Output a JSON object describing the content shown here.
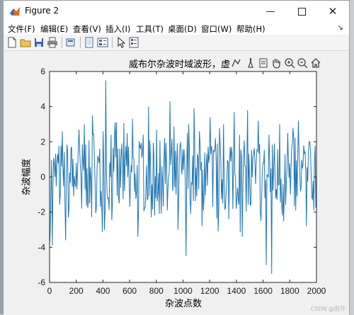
{
  "window": {
    "title": "Figure 2"
  },
  "menu": [
    "文件(F)",
    "编辑(E)",
    "查看(V)",
    "插入(I)",
    "工具(T)",
    "桌面(D)",
    "窗口(W)",
    "帮助(H)"
  ],
  "toolbar_icons": [
    "new-figure-icon",
    "open-file-icon",
    "save-icon",
    "print-icon",
    "print-preview-icon",
    "dock-icon",
    "insert-legend-icon",
    "edit-plot-arrow-icon",
    "property-inspector-icon"
  ],
  "axes_toolbar_icons": [
    "data-tips-icon",
    "brush-icon",
    "restore-icon",
    "pan-hand-icon",
    "zoom-in-icon",
    "zoom-out-icon",
    "home-icon"
  ],
  "colors": {
    "line": "#1f77b4",
    "axes_bg": "#ffffff"
  },
  "watermark": "CSDN @雨开",
  "chart_data": {
    "type": "line",
    "title": "威布尔杂波时域波形，虚",
    "xlabel": "杂波点数",
    "ylabel": "杂波幅度",
    "xlim": [
      0,
      2000
    ],
    "ylim": [
      -6,
      6
    ],
    "xticks": [
      0,
      200,
      400,
      600,
      800,
      1000,
      1200,
      1400,
      1600,
      1800,
      2000
    ],
    "yticks": [
      -6,
      -4,
      -2,
      0,
      2,
      4,
      6
    ],
    "grid": false,
    "n_points": 400,
    "peaks": [
      [
        -3.9,
        0,
        1.3,
        -1,
        0.5,
        -3.6,
        -2.3,
        1.6,
        -1.1,
        0.8
      ],
      [
        2.7,
        -1.8,
        3.0,
        0.5,
        -1.5,
        3.5,
        -0.3,
        1.2,
        -1.7,
        2.6
      ],
      [
        5.5,
        -1.2,
        2.4,
        0.3,
        3.1,
        -1.5,
        1.9,
        -0.8,
        2.5,
        -1.7
      ],
      [
        3.3,
        0.2,
        -3.4,
        1.6,
        2.4,
        -0.6,
        4.0,
        -2.3,
        1.1,
        2.7
      ],
      [
        -2.1,
        0.6,
        2.2,
        -1.9,
        4.3,
        -0.8,
        1.5,
        -3.0,
        2.0,
        0.4
      ],
      [
        -4.5,
        3.0,
        -0.3,
        3.9,
        -1.1,
        2.6,
        -2.8,
        1.4,
        -0.5,
        3.4
      ],
      [
        -1.7,
        2.2,
        -3.1,
        0.9,
        3.0,
        -0.9,
        -2.4,
        1.7,
        3.7,
        -1.2
      ],
      [
        2.4,
        -3.4,
        0.6,
        3.8,
        -1.6,
        1.1,
        -0.4,
        3.2,
        -2.5,
        0.8
      ],
      [
        -5.0,
        2.4,
        -5.5,
        1.9,
        -1.3,
        3.0,
        -2.2,
        1.3,
        2.5,
        -1.0
      ],
      [
        2.8,
        -1.9,
        3.2,
        -0.6,
        1.8,
        -2.8,
        2.0,
        -1.2,
        1.0,
        -3.6
      ]
    ]
  }
}
